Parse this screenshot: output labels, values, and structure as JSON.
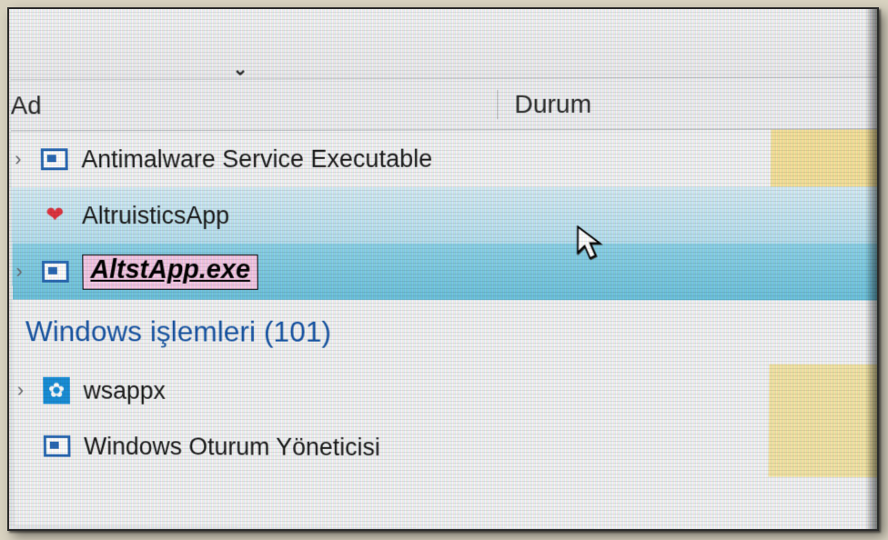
{
  "headers": {
    "name": "Ad",
    "status": "Durum"
  },
  "processes": [
    {
      "name": "Antimalware Service Executable",
      "icon": "process-icon",
      "expandable": true,
      "selected": false
    },
    {
      "name": "AltruisticsApp",
      "icon": "heart-icon",
      "expandable": false,
      "selected": "light"
    },
    {
      "name": "AltstApp.exe",
      "icon": "process-icon",
      "expandable": true,
      "selected": "dark",
      "highlighted": true
    }
  ],
  "group": {
    "label": "Windows işlemleri (101)"
  },
  "win_processes": [
    {
      "name": "wsappx",
      "icon": "gear-icon",
      "expandable": true
    },
    {
      "name": "Windows Oturum Yöneticisi",
      "icon": "process-icon",
      "expandable": false
    }
  ]
}
